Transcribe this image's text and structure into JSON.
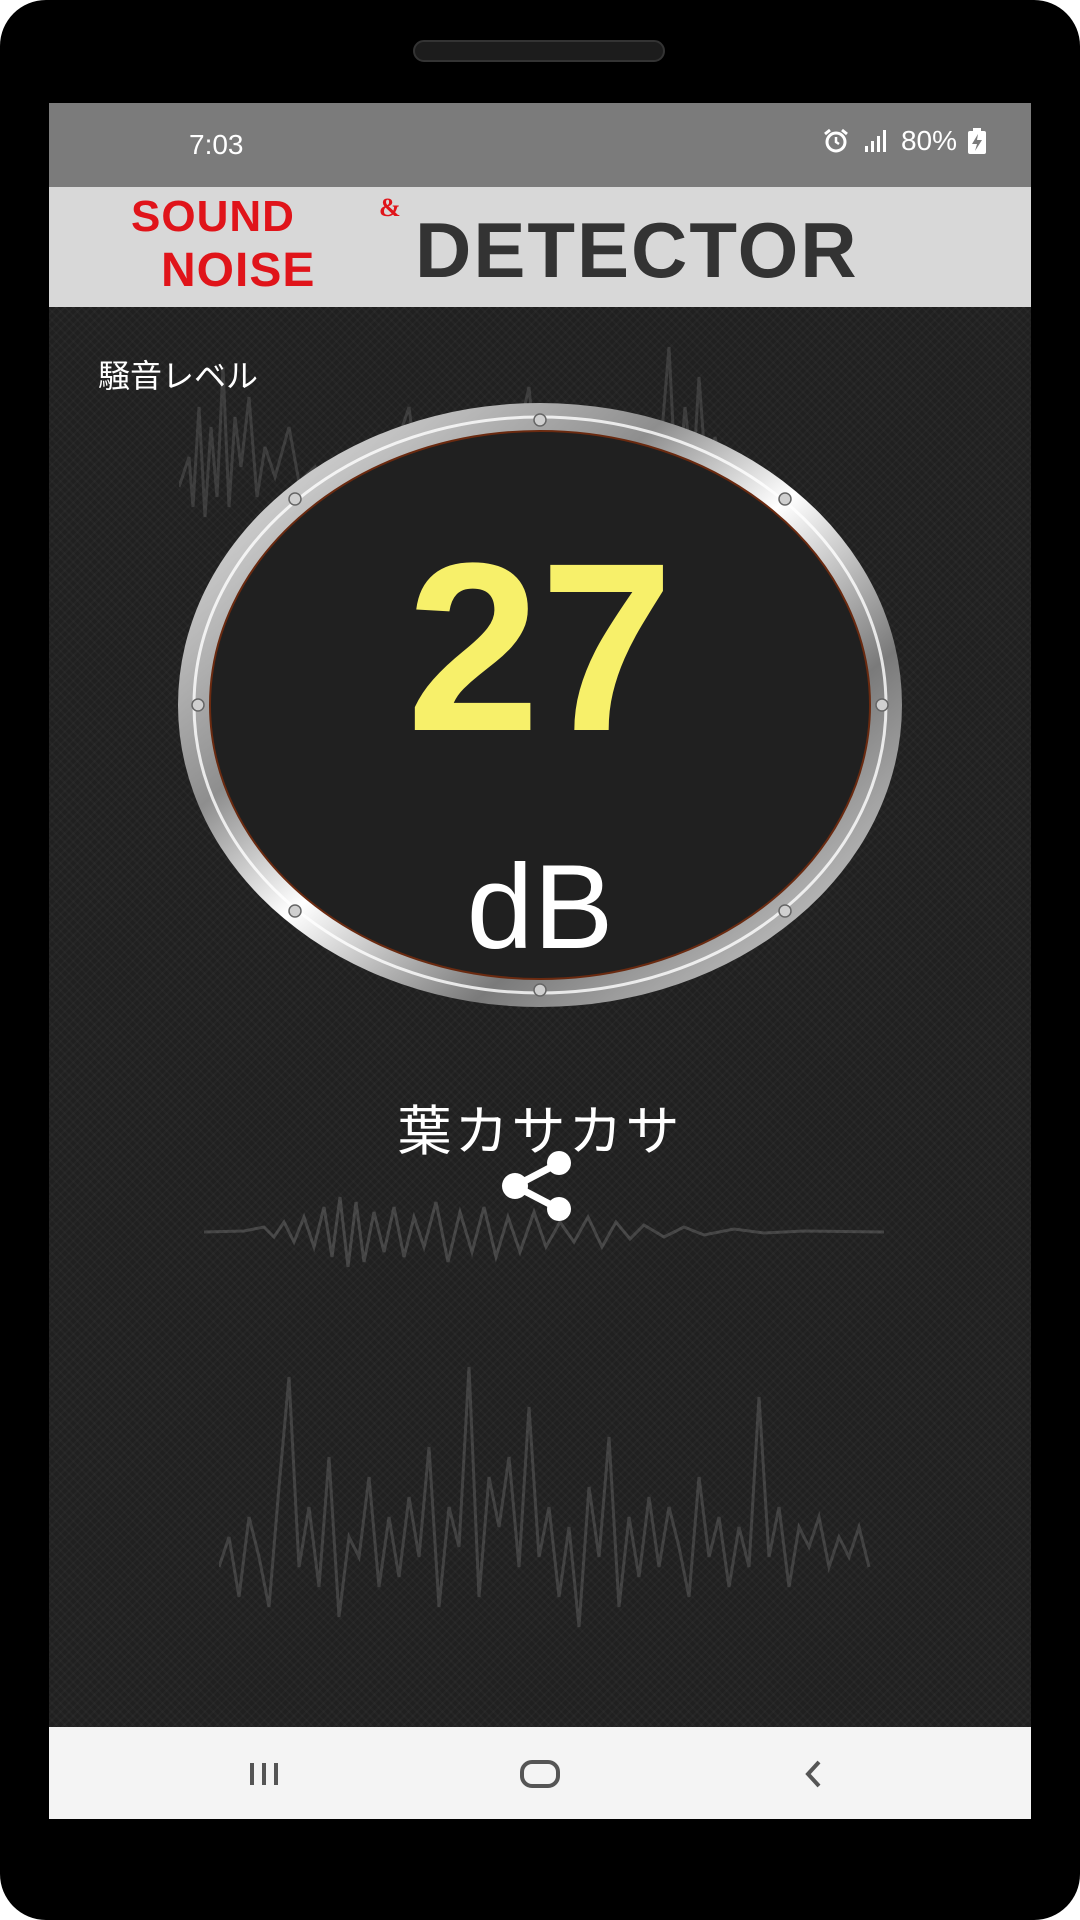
{
  "status": {
    "time": "7:03",
    "battery": "80%",
    "icons": [
      "alarm-icon",
      "signal-icon",
      "battery-charging-icon"
    ]
  },
  "header": {
    "logo_sound": "SOUND",
    "logo_amp": "&",
    "logo_noise": "NOISE",
    "logo_detector": "DETECTOR"
  },
  "main": {
    "noise_label": "騒音レベル",
    "level_value": "27",
    "unit": "dB",
    "description": "葉カサカサ",
    "share_icon": "share-icon"
  },
  "colors": {
    "value": "#f7f06a",
    "logo_red": "#e0141a",
    "logo_dark": "#333333"
  },
  "navbar": {
    "icons": [
      "recent-apps-icon",
      "home-icon",
      "back-icon"
    ]
  }
}
